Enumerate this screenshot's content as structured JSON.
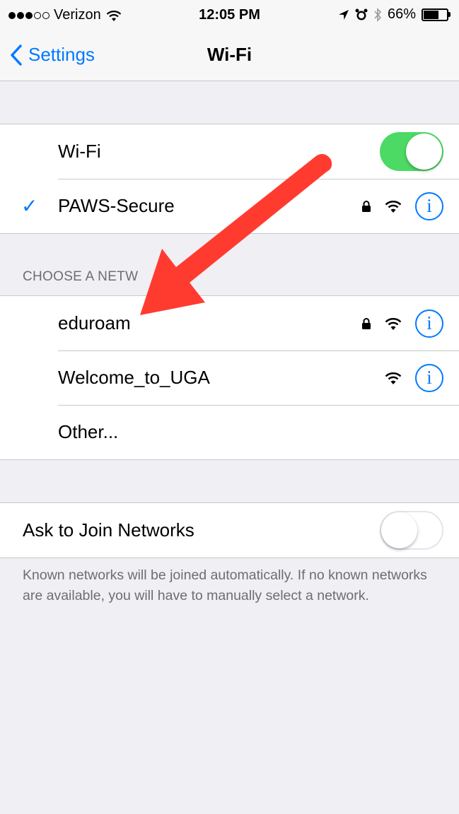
{
  "status_bar": {
    "carrier": "Verizon",
    "time": "12:05 PM",
    "battery_percent": "66%",
    "battery_level": 0.66,
    "signal_bars_filled": 3,
    "signal_bars_total": 5
  },
  "nav": {
    "back_label": "Settings",
    "title": "Wi-Fi"
  },
  "wifi": {
    "label": "Wi-Fi",
    "enabled": true,
    "connected_network": "PAWS-Secure"
  },
  "choose_section": {
    "header": "CHOOSE A NETW",
    "networks": [
      {
        "name": "eduroam",
        "secured": true
      },
      {
        "name": "Welcome_to_UGA",
        "secured": false
      },
      {
        "name": "Other..."
      }
    ]
  },
  "ask_to_join": {
    "label": "Ask to Join Networks",
    "enabled": false,
    "footer": "Known networks will be joined automatically. If no known networks are available, you will have to manually select a network."
  },
  "colors": {
    "accent": "#007aff",
    "toggle_on": "#4cd964",
    "arrow": "#ff3b30",
    "background": "#efeff4"
  },
  "icons": [
    "wifi-icon",
    "lock-icon",
    "info-icon",
    "location-icon",
    "alarm-icon",
    "bluetooth-icon",
    "battery-icon",
    "chevron-left-icon",
    "checkmark-icon"
  ]
}
